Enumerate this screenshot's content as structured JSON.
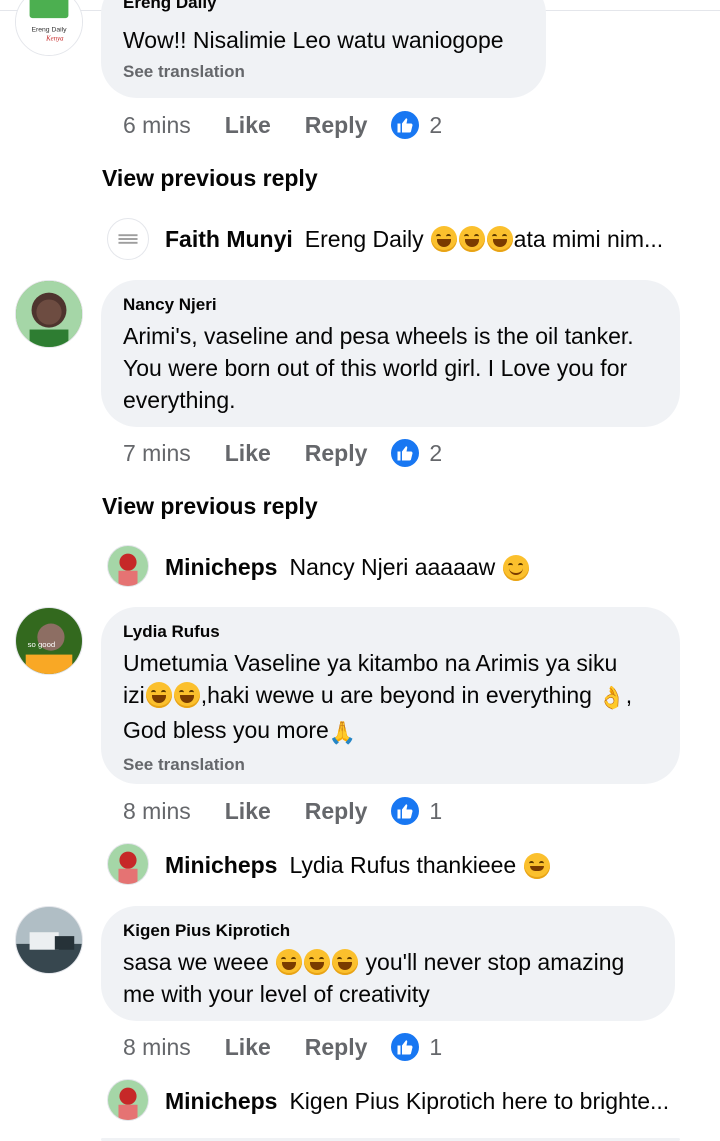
{
  "comments": [
    {
      "author": "Ereng Daily",
      "text": "Wow!! Nisalimie Leo watu waniogope",
      "see_translation": "See translation",
      "time": "6 mins",
      "like": "Like",
      "reply": "Reply",
      "likes": "2",
      "avatar_text": "Ereng Daily",
      "avatar_text2": "Kenya"
    },
    {
      "author": "Nancy Njeri",
      "text_lines": [
        "Arimi's, vaseline and pesa wheels is the oil tanker.",
        "You were born out of this world girl. I Love you for",
        "everything."
      ],
      "time": "7 mins",
      "like": "Like",
      "reply": "Reply",
      "likes": "2"
    },
    {
      "author": "Lydia Rufus",
      "line1": "Umetumia Vaseline ya kitambo na Arimis ya siku",
      "line2a": "izi",
      "line2b": ",haki wewe u are beyond in everything",
      "line2c": ",",
      "line3": "God bless you more",
      "see_translation": "See translation",
      "time": "8 mins",
      "like": "Like",
      "reply": "Reply",
      "likes": "1",
      "avatar_text": "so good"
    },
    {
      "author": "Kigen Pius Kiprotich",
      "line1a": "sasa we weee",
      "line1b": "you'll never stop amazing",
      "line2": "me with your level of creativity",
      "time": "8 mins",
      "like": "Like",
      "reply": "Reply",
      "likes": "1"
    }
  ],
  "view_previous": "View previous reply",
  "replies": [
    {
      "name": "Faith Munyi",
      "text_a": "Ereng Daily",
      "text_b": "ata mimi nim..."
    },
    {
      "name": "Minicheps",
      "text": "Nancy Njeri aaaaaw"
    },
    {
      "name": "Minicheps",
      "text": "Lydia Rufus thankieee"
    },
    {
      "name": "Minicheps",
      "text": "Kigen Pius Kiprotich here to brighte..."
    }
  ],
  "colors": {
    "like_blue": "#1877f2",
    "bubble": "#f0f2f5",
    "meta_gray": "#65676b"
  }
}
